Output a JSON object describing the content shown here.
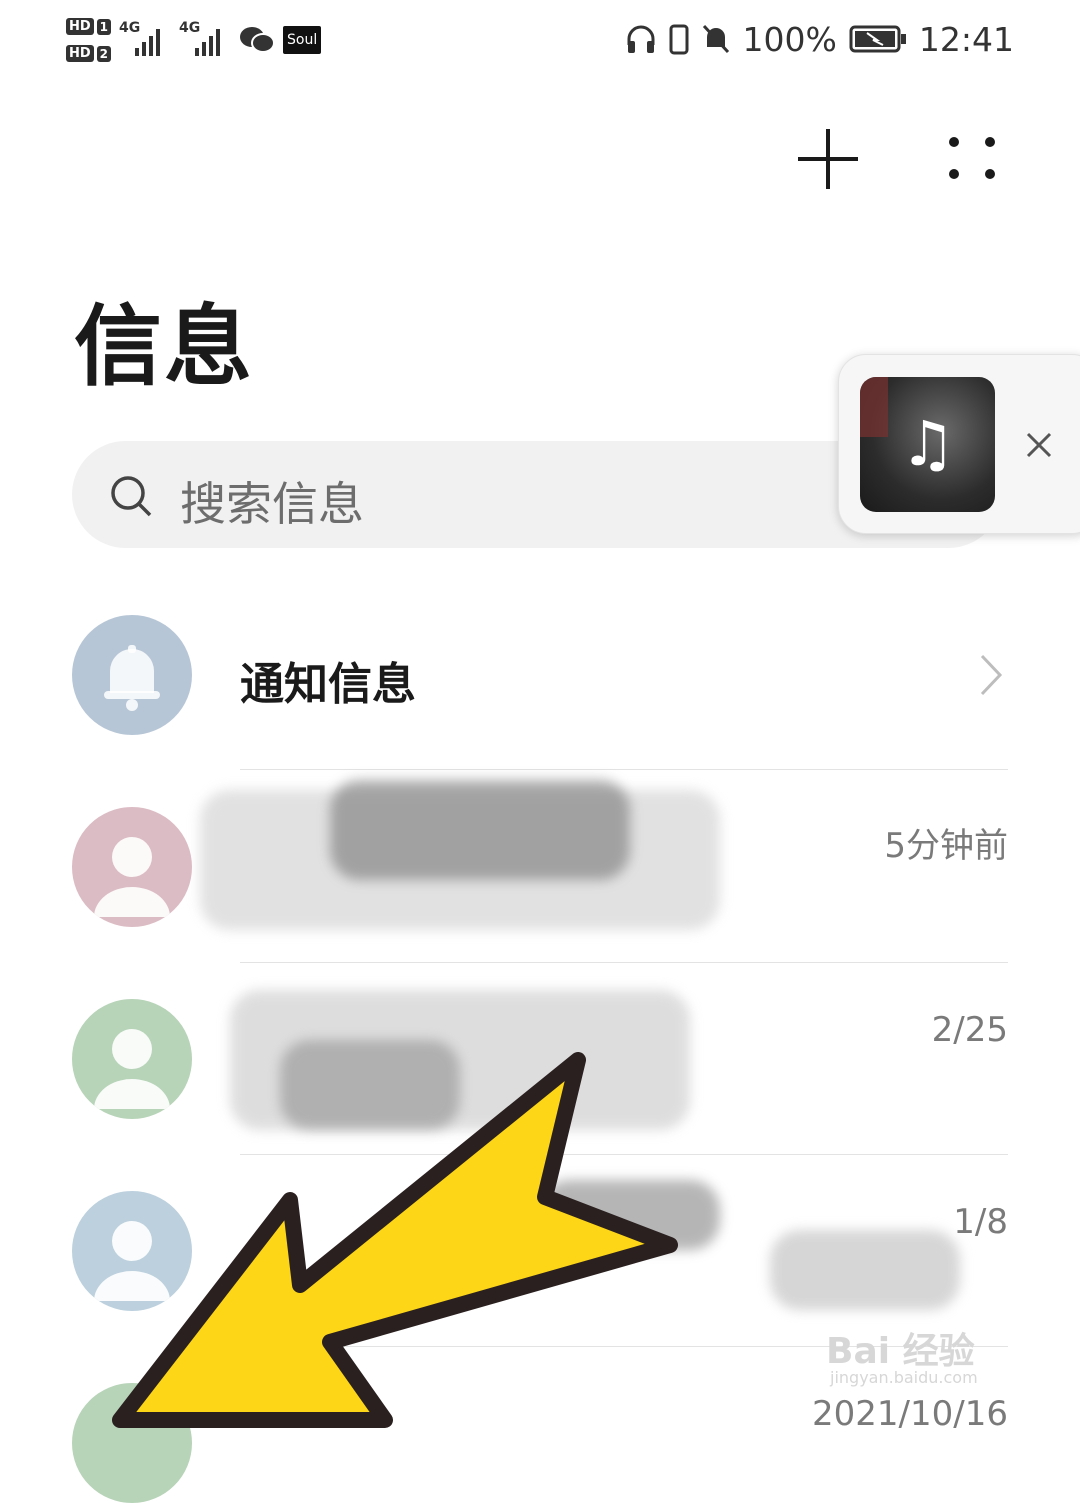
{
  "status_bar": {
    "hd1": "HD",
    "hd1_num": "1",
    "hd2": "HD",
    "hd2_num": "2",
    "net1": "4G",
    "net2": "4G",
    "soul_label": "Soul",
    "battery_percent": "100%",
    "time": "12:41"
  },
  "page": {
    "title": "信息"
  },
  "search": {
    "placeholder": "搜索信息"
  },
  "conversations": [
    {
      "title": "通知信息",
      "time": "",
      "avatar_color": "#b7c6d6"
    },
    {
      "title": "",
      "time": "5分钟前",
      "avatar_color": "#dcbcc4"
    },
    {
      "title": "",
      "time": "2/25",
      "avatar_color": "#b7d3b8"
    },
    {
      "title": "",
      "time": "1/8",
      "avatar_color": "#bcd0dd"
    },
    {
      "title": "",
      "time": "2021/10/16",
      "avatar_color": "#b7d3b8"
    }
  ],
  "watermark": {
    "brand": "Bai 经验",
    "url": "jingyan.baidu.com"
  },
  "colors": {
    "arrow_fill": "#fcd617",
    "arrow_stroke": "#2b2020"
  }
}
